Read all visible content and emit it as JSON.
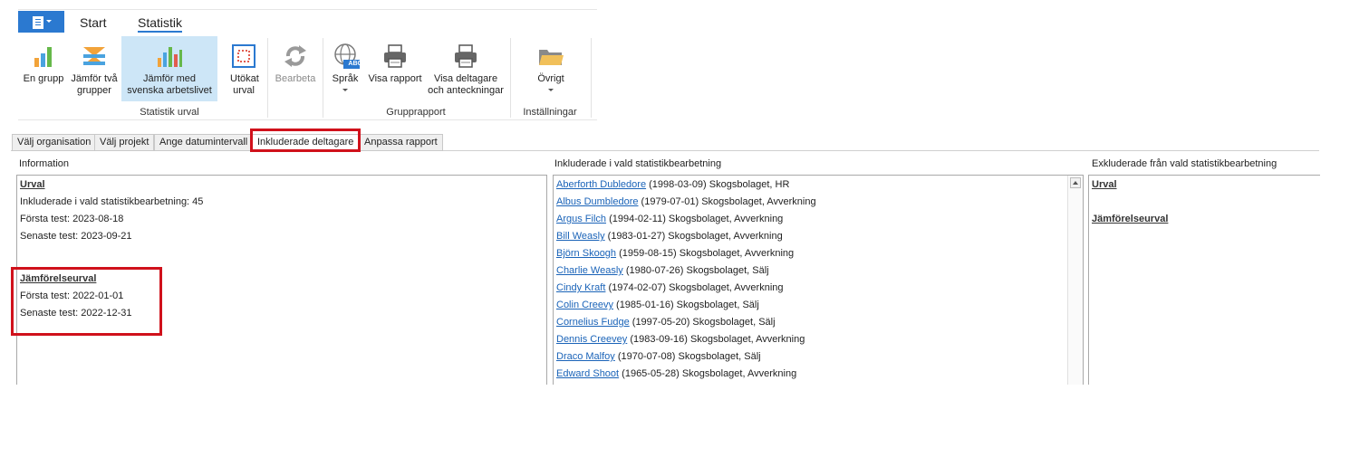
{
  "ribbon": {
    "tabs": [
      {
        "label": "Start"
      },
      {
        "label": "Statistik"
      }
    ],
    "buttons": [
      {
        "label": "En grupp"
      },
      {
        "label": "Jämför två grupper"
      },
      {
        "label": "Jämför med svenska arbetslivet"
      },
      {
        "label": "Utökat urval"
      },
      {
        "label": "Bearbeta"
      },
      {
        "label": "Språk"
      },
      {
        "label": "Visa rapport"
      },
      {
        "label": "Visa deltagare och anteckningar"
      },
      {
        "label": "Övrigt"
      }
    ],
    "groups": [
      {
        "label": "Statistik urval"
      },
      {
        "label": "Grupprapport"
      },
      {
        "label": "Inställningar"
      }
    ],
    "abc_badge": "ABC"
  },
  "wizard_tabs": [
    {
      "label": "Välj organisation"
    },
    {
      "label": "Välj projekt"
    },
    {
      "label": "Ange datumintervall"
    },
    {
      "label": "Inkluderade deltagare"
    },
    {
      "label": "Anpassa rapport"
    }
  ],
  "info": {
    "title": "Information",
    "urval_heading": "Urval",
    "included": "Inkluderade i vald statistikbearbetning: 45",
    "first_test": "Första test: 2023-08-18",
    "last_test": "Senaste test: 2023-09-21",
    "jamfor_heading": "Jämförelseurval",
    "jamfor_first": "Första test: 2022-01-01",
    "jamfor_last": "Senaste test: 2022-12-31"
  },
  "included": {
    "title": "Inkluderade i vald statistikbearbetning",
    "rows": [
      {
        "name": "Aberforth Dubledore",
        "details": " (1998-03-09) Skogsbolaget, HR"
      },
      {
        "name": "Albus Dumbledore",
        "details": " (1979-07-01) Skogsbolaget, Avverkning"
      },
      {
        "name": "Argus Filch",
        "details": " (1994-02-11) Skogsbolaget, Avverkning"
      },
      {
        "name": "Bill Weasly",
        "details": " (1983-01-27) Skogsbolaget, Avverkning"
      },
      {
        "name": "Björn Skoogh",
        "details": " (1959-08-15) Skogsbolaget, Avverkning"
      },
      {
        "name": "Charlie Weasly",
        "details": " (1980-07-26) Skogsbolaget, Sälj"
      },
      {
        "name": "Cindy Kraft",
        "details": " (1974-02-07) Skogsbolaget, Avverkning"
      },
      {
        "name": "Colin Creevy",
        "details": " (1985-01-16) Skogsbolaget, Sälj"
      },
      {
        "name": "Cornelius Fudge",
        "details": " (1997-05-20) Skogsbolaget, Sälj"
      },
      {
        "name": "Dennis Creevey",
        "details": " (1983-09-16) Skogsbolaget, Avverkning"
      },
      {
        "name": "Draco Malfoy",
        "details": " (1970-07-08) Skogsbolaget, Sälj"
      },
      {
        "name": "Edward Shoot",
        "details": " (1965-05-28) Skogsbolaget, Avverkning"
      }
    ]
  },
  "excluded": {
    "title": "Exkluderade från vald statistikbearbetning",
    "urval_heading": "Urval",
    "jamfor_heading": "Jämförelseurval"
  },
  "colors": {
    "accent": "#2b79d0",
    "highlight": "#d0111b",
    "selected": "#cde6f7",
    "link": "#1a63b8"
  }
}
